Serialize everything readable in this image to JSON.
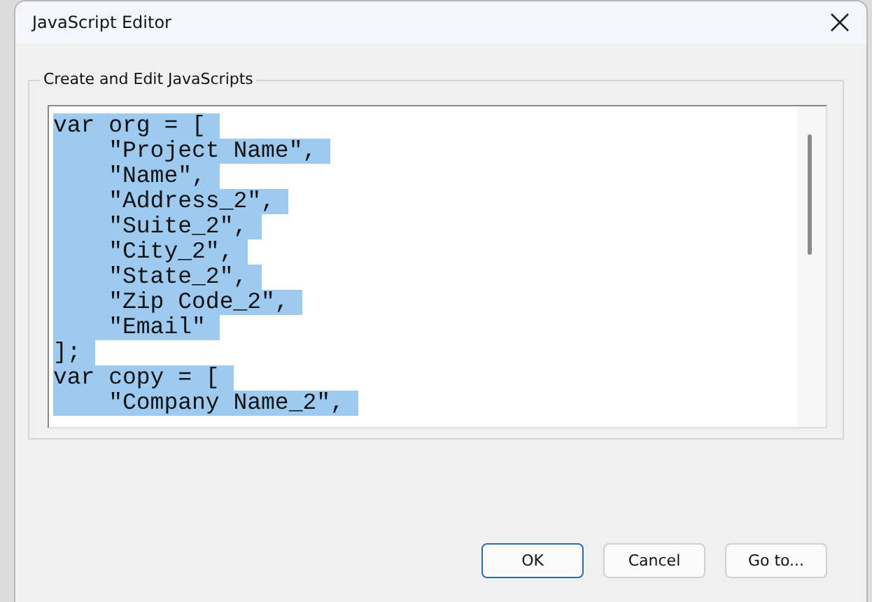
{
  "window": {
    "title": "JavaScript Editor"
  },
  "group": {
    "label": "Create and Edit JavaScripts"
  },
  "editor": {
    "selected": true,
    "lines": [
      "var org = [",
      "    \"Project Name\",",
      "    \"Name\",",
      "    \"Address_2\",",
      "    \"Suite_2\",",
      "    \"City_2\",",
      "    \"State_2\",",
      "    \"Zip Code_2\",",
      "    \"Email\"",
      "];",
      "var copy = [",
      "    \"Company Name_2\","
    ]
  },
  "buttons": [
    {
      "label": "OK",
      "default": true
    },
    {
      "label": "Cancel",
      "default": false
    },
    {
      "label": "Go to...",
      "default": false
    }
  ]
}
